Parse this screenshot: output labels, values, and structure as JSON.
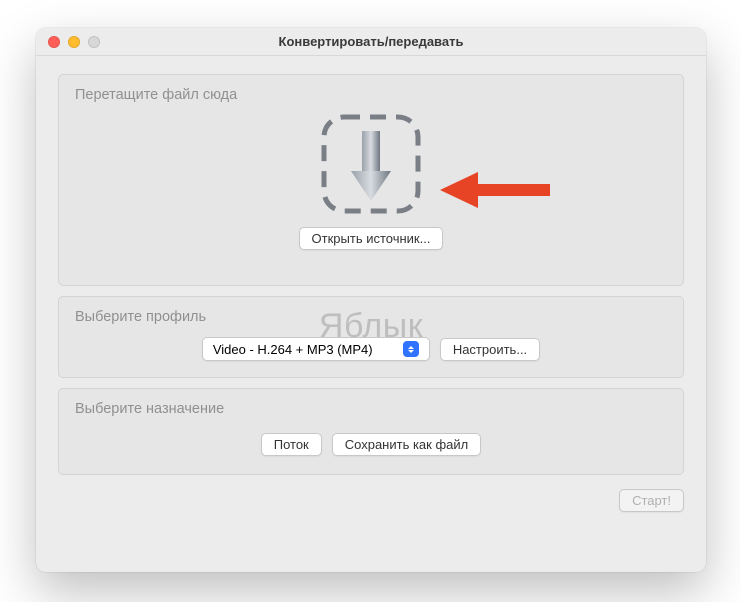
{
  "window": {
    "title": "Конвертировать/передавать"
  },
  "drop": {
    "section_title": "Перетащите файл сюда",
    "open_button": "Открыть источник..."
  },
  "profile": {
    "section_title": "Выберите профиль",
    "selected": "Video - H.264 + MP3 (MP4)",
    "customize_button": "Настроить..."
  },
  "destination": {
    "section_title": "Выберите назначение",
    "stream_button": "Поток",
    "save_file_button": "Сохранить как файл"
  },
  "footer": {
    "start_button": "Старт!"
  },
  "watermark": "Яблык"
}
